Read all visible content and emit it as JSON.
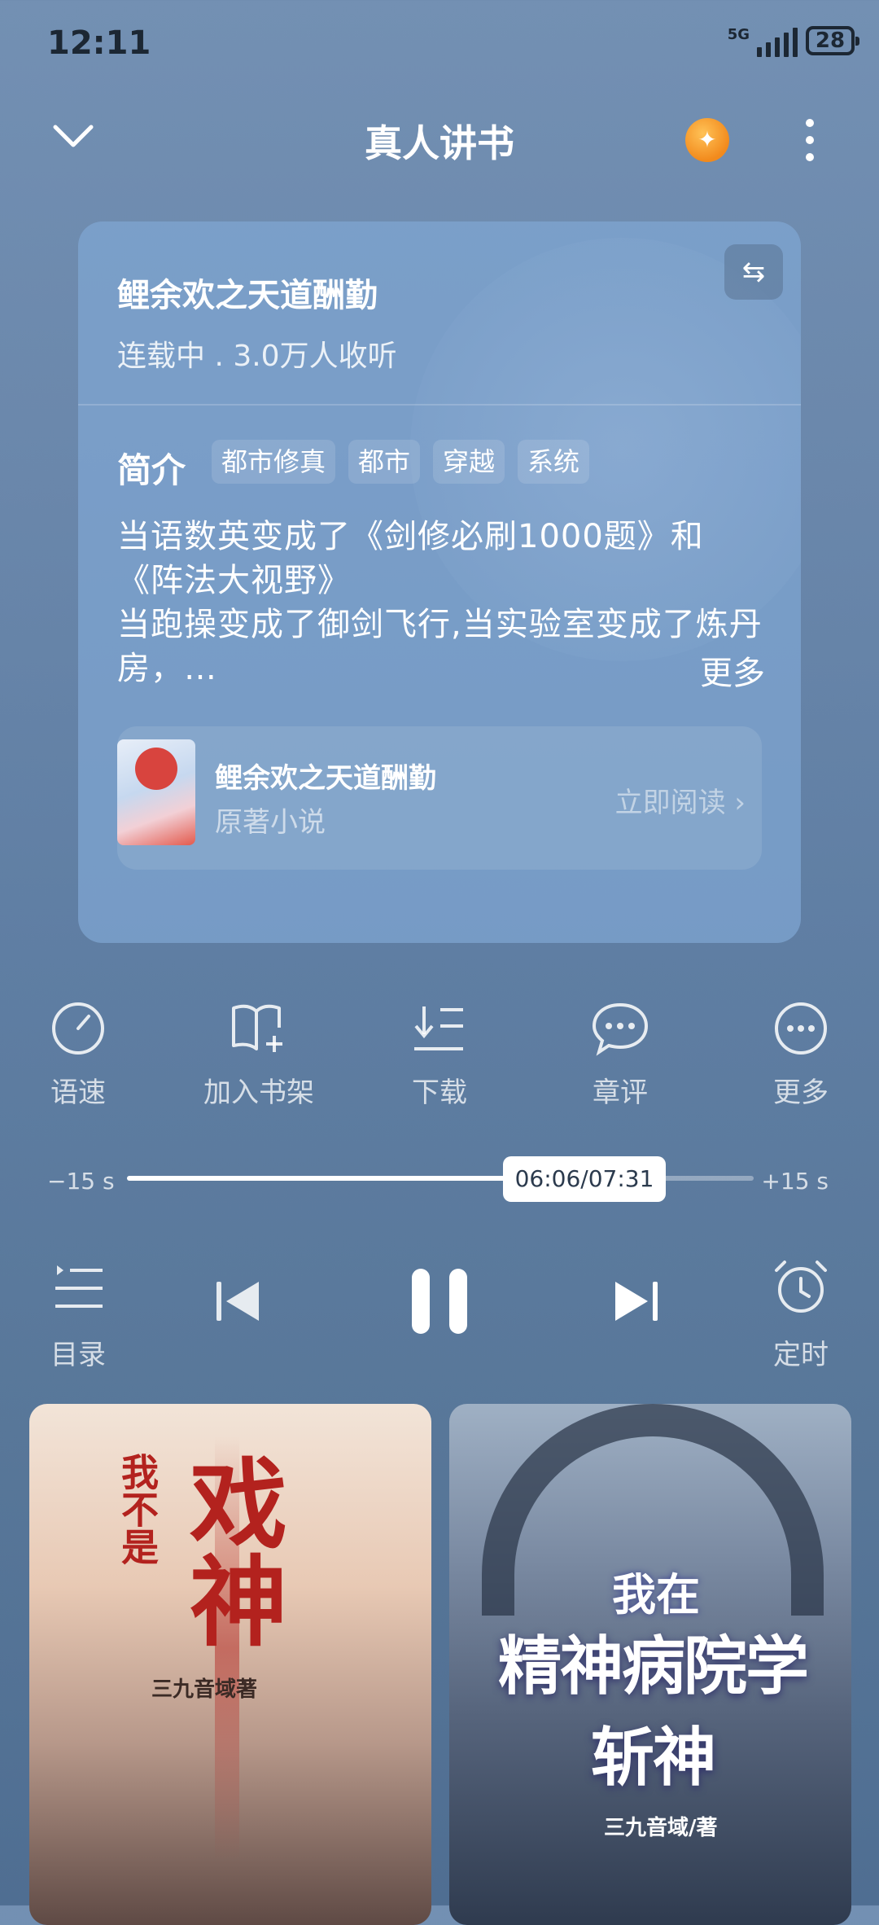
{
  "status_bar": {
    "time": "12:11",
    "network": "5G",
    "battery": "28"
  },
  "header": {
    "title": "真人讲书"
  },
  "book": {
    "title": "鲤余欢之天道酬勤",
    "meta": "连载中 . 3.0万人收听",
    "intro_label": "简介",
    "tags": [
      "都市修真",
      "都市",
      "穿越",
      "系统"
    ],
    "description": "当语数英变成了《剑修必刷1000题》和《阵法大视野》\n当跑操变成了御剑飞行,当实验室变成了炼丹房，…",
    "more": "更多",
    "original": {
      "title": "鲤余欢之天道酬勤",
      "subtitle": "原著小说",
      "action": "立即阅读"
    }
  },
  "actions": [
    {
      "label": "语速",
      "icon": "speed-icon"
    },
    {
      "label": "加入书架",
      "icon": "add-bookshelf-icon"
    },
    {
      "label": "下载",
      "icon": "download-icon"
    },
    {
      "label": "章评",
      "icon": "comment-icon"
    },
    {
      "label": "更多",
      "icon": "more-icon"
    }
  ],
  "player": {
    "rewind": "−15 s",
    "forward": "+15 s",
    "position": "06:06/07:31",
    "progress_fraction": 0.81,
    "toc_label": "目录",
    "timer_label": "定时"
  },
  "recommendations": [
    {
      "small": "我不是",
      "title": "戏神",
      "author": "三九音域著"
    },
    {
      "small": "我在",
      "title": "精神病院学斩神",
      "author": "三九音域/著"
    }
  ]
}
